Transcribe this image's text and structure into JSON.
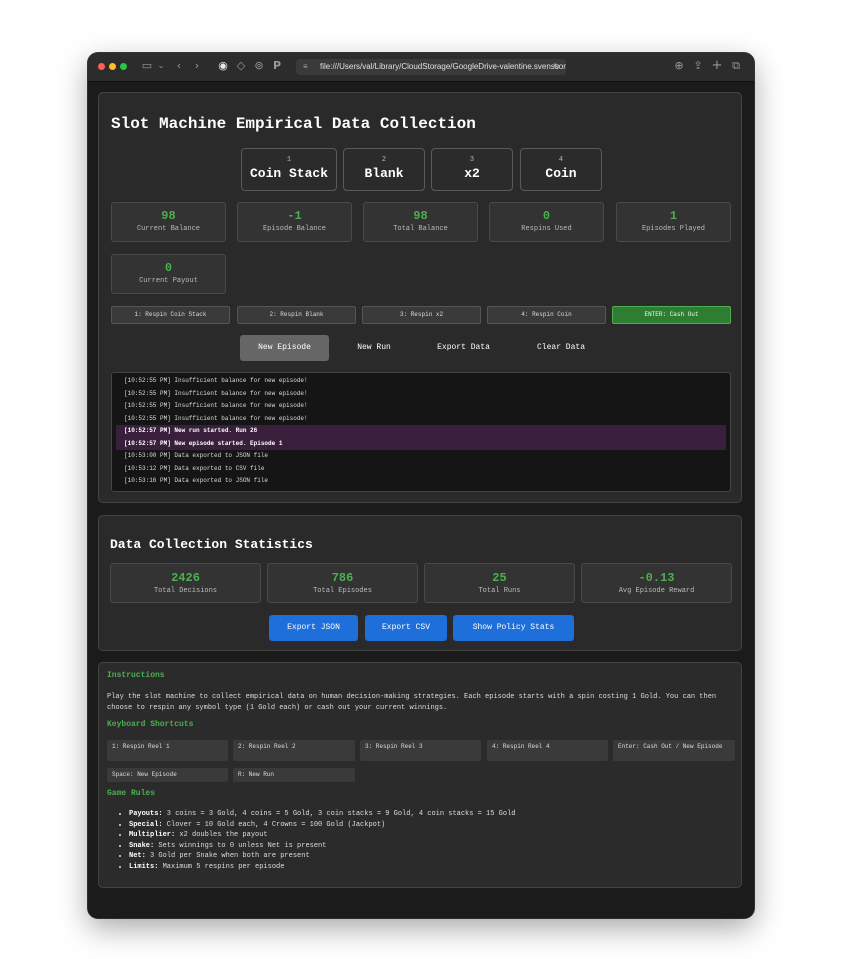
{
  "browser": {
    "url": "file:///Users/val/Library/CloudStorage/GoogleDrive-valentine.svensson"
  },
  "game": {
    "title": "Slot Machine Empirical Data Collection",
    "symbols": [
      {
        "index": "1",
        "label": "Coin Stack"
      },
      {
        "index": "2",
        "label": "Blank"
      },
      {
        "index": "3",
        "label": "x2"
      },
      {
        "index": "4",
        "label": "Coin"
      }
    ],
    "stats": [
      {
        "value": "98",
        "label": "Current Balance"
      },
      {
        "value": "-1",
        "label": "Episode Balance"
      },
      {
        "value": "98",
        "label": "Total Balance"
      },
      {
        "value": "0",
        "label": "Respins Used"
      },
      {
        "value": "1",
        "label": "Episodes Played"
      },
      {
        "value": "0",
        "label": "Current Payout"
      }
    ],
    "respin_buttons": [
      "1: Respin Coin Stack",
      "2: Respin Blank",
      "3: Respin x2",
      "4: Respin Coin"
    ],
    "cashout_button": "ENTER: Cash Out",
    "actions": {
      "new_episode": "New Episode",
      "new_run": "New Run",
      "export_data": "Export Data",
      "clear_data": "Clear Data"
    },
    "log": [
      "[10:52:55 PM] Insufficient balance for new episode!",
      "[10:52:55 PM] Insufficient balance for new episode!",
      "[10:52:55 PM] Insufficient balance for new episode!",
      "[10:52:55 PM] Insufficient balance for new episode!",
      "[10:52:57 PM] New run started. Run 26",
      "[10:52:57 PM] New episode started. Episode 1",
      "[10:53:00 PM] Data exported to JSON file",
      "[10:53:12 PM] Data exported to CSV file",
      "[10:53:16 PM] Data exported to JSON file"
    ]
  },
  "collection": {
    "title": "Data Collection Statistics",
    "stats": [
      {
        "value": "2426",
        "label": "Total Decisions"
      },
      {
        "value": "786",
        "label": "Total Episodes"
      },
      {
        "value": "25",
        "label": "Total Runs"
      },
      {
        "value": "-0.13",
        "label": "Avg Episode Reward"
      }
    ],
    "buttons": {
      "export_json": "Export JSON",
      "export_csv": "Export CSV",
      "policy_stats": "Show Policy Stats"
    }
  },
  "instructions": {
    "heading": "Instructions",
    "text": "Play the slot machine to collect empirical data on human decision-making strategies. Each episode starts with a spin costing 1 Gold. You can then choose to respin any symbol type (1 Gold each) or cash out your current winnings.",
    "shortcuts_heading": "Keyboard Shortcuts",
    "shortcuts": [
      "1: Respin Reel 1",
      "2: Respin Reel 2",
      "3: Respin Reel 3",
      "4: Respin Reel 4",
      "Enter: Cash Out / New Episode",
      "Space: New Episode",
      "R: New Run"
    ],
    "rules_heading": "Game Rules",
    "rules": [
      {
        "label": "Payouts:",
        "text": " 3 coins = 3 Gold, 4 coins = 5 Gold, 3 coin stacks = 9 Gold, 4 coin stacks = 15 Gold"
      },
      {
        "label": "Special:",
        "text": " Clover = 10 Gold each, 4 Crowns = 100 Gold (Jackpot)"
      },
      {
        "label": "Multiplier:",
        "text": " x2 doubles the payout"
      },
      {
        "label": "Snake:",
        "text": " Sets winnings to 0 unless Net is present"
      },
      {
        "label": "Net:",
        "text": " 3 Gold per Snake when both are present"
      },
      {
        "label": "Limits:",
        "text": " Maximum 5 respins per episode"
      }
    ]
  }
}
